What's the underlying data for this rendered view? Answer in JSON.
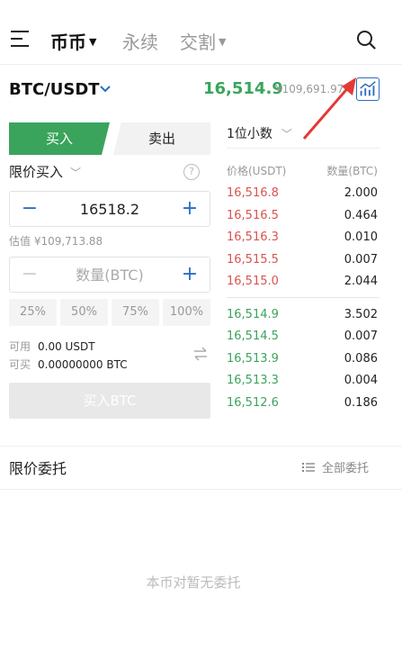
{
  "nav": {
    "tabs": [
      {
        "label": "币币",
        "active": true,
        "has_caret": true
      },
      {
        "label": "永续",
        "active": false,
        "has_caret": false
      },
      {
        "label": "交割",
        "active": false,
        "has_caret": true
      }
    ],
    "menu_icon": "hamburger-menu-icon",
    "search_icon": "search-icon"
  },
  "pair": {
    "name": "BTC/USDT",
    "last_price": "16,514.9",
    "cny_price": "¥109,691.97",
    "chart_icon": "chart-icon",
    "price_color": "#3aa45c"
  },
  "trade": {
    "buy_tab": "买入",
    "sell_tab": "卖出",
    "order_type": "限价买入",
    "price_value": "16518.2",
    "estimate": "估值 ¥109,713.88",
    "qty_placeholder": "数量(BTC)",
    "percents": [
      "25%",
      "50%",
      "75%",
      "100%"
    ],
    "available_label": "可用",
    "available_value": "0.00 USDT",
    "buyable_label": "可买",
    "buyable_value": "0.00000000 BTC",
    "buy_button": "买入BTC",
    "accent_color": "#2b6cc4",
    "buy_color": "#3aa45c"
  },
  "orderbook": {
    "precision": "1位小数",
    "price_header": "价格(USDT)",
    "qty_header": "数量(BTC)",
    "asks": [
      {
        "price": "16,516.8",
        "qty": "2.000"
      },
      {
        "price": "16,516.5",
        "qty": "0.464"
      },
      {
        "price": "16,516.3",
        "qty": "0.010"
      },
      {
        "price": "16,515.5",
        "qty": "0.007"
      },
      {
        "price": "16,515.0",
        "qty": "2.044"
      }
    ],
    "bids": [
      {
        "price": "16,514.9",
        "qty": "3.502"
      },
      {
        "price": "16,514.5",
        "qty": "0.007"
      },
      {
        "price": "16,513.9",
        "qty": "0.086"
      },
      {
        "price": "16,513.3",
        "qty": "0.004"
      },
      {
        "price": "16,512.6",
        "qty": "0.186"
      }
    ],
    "ask_color": "#d9534f",
    "bid_color": "#3aa45c"
  },
  "orders": {
    "title": "限价委托",
    "all_label": "全部委托",
    "empty_text": "本币对暂无委托"
  }
}
